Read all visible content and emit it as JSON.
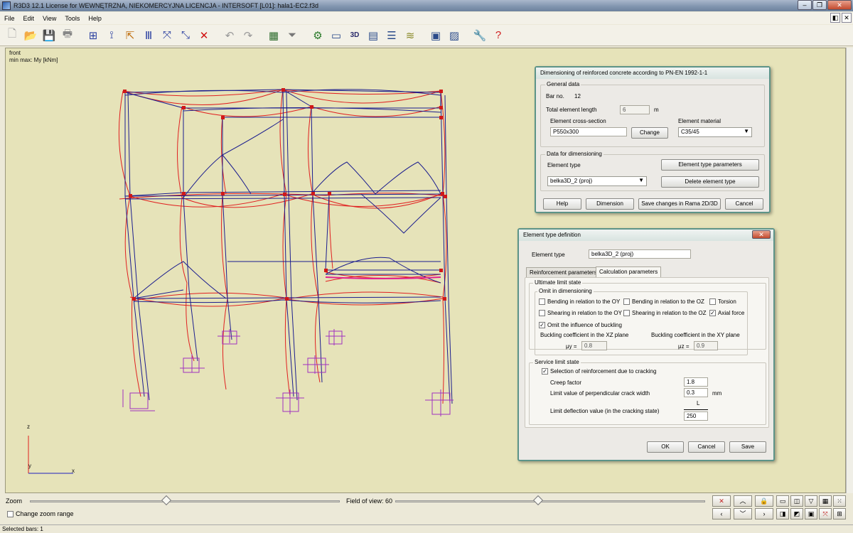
{
  "window": {
    "title": "R3D3 12.1 License for WEWNĘTRZNA, NIEKOMERCYJNA LICENCJA - INTERSOFT [L01]: hala1-EC2.f3d"
  },
  "menu": {
    "file": "File",
    "edit": "Edit",
    "view": "View",
    "tools": "Tools",
    "help": "Help"
  },
  "viewport": {
    "view_name": "front",
    "result_label": "min max: My [kNm]",
    "axis_z": "z",
    "axis_y": "y",
    "axis_x": "x"
  },
  "dim_dialog": {
    "title": "Dimensioning of reinforced concrete according to PN-EN 1992-1-1",
    "general_data": "General data",
    "bar_no_label": "Bar no.",
    "bar_no_value": "12",
    "length_label": "Total element length",
    "length_value": "6",
    "length_unit": "m",
    "cross_section_label": "Element cross-section",
    "cross_section_value": "P550x300",
    "change_button": "Change",
    "material_label": "Element material",
    "material_value": "C35/45",
    "data_for_dim": "Data for dimensioning",
    "element_type_label": "Element type",
    "element_type_value": "belka3D_2 (proj)",
    "element_type_params_button": "Element type parameters",
    "delete_element_type_button": "Delete element type",
    "help_button": "Help",
    "dimension_button": "Dimension",
    "save_changes_button": "Save changes in Rama 2D/3D",
    "cancel_button": "Cancel"
  },
  "type_dialog": {
    "title": "Element type definition",
    "element_type_label": "Element type",
    "element_type_value": "belka3D_2 (proj)",
    "tab_reinforcement": "Reinforcement parameters",
    "tab_calculation": "Calculation parameters",
    "uls_label": "Ultimate limit state",
    "omit_label": "Omit in dimensioning",
    "cb_bend_oy": "Bending in relation to the OY",
    "cb_bend_oz": "Bending in relation to the OZ",
    "cb_torsion": "Torsion",
    "cb_shear_oy": "Shearing in relation to the OY",
    "cb_shear_oz": "Shearing in relation to the OZ",
    "cb_axial": "Axial force",
    "cb_buckling": "Omit the influence of buckling",
    "buckling_xz_label": "Buckling coefficient in the XZ plane",
    "buckling_xy_label": "Buckling coefficient in the XY plane",
    "mu_y_label": "μy =",
    "mu_y_value": "0.8",
    "mu_z_label": "μz =",
    "mu_z_value": "0.9",
    "sls_label": "Service limit state",
    "cb_cracking": "Selection of reinforcement due to cracking",
    "creep_label": "Creep factor",
    "creep_value": "1.8",
    "crack_width_label": "Limit value of perpendicular crack width",
    "crack_width_value": "0.3",
    "crack_width_unit": "mm",
    "deflection_label": "Limit deflection value (in the cracking state)",
    "deflection_fraction": "L",
    "deflection_value": "250",
    "ok_button": "OK",
    "cancel_button": "Cancel",
    "save_button": "Save",
    "checked": {
      "bend_oy": false,
      "bend_oz": false,
      "torsion": false,
      "shear_oy": false,
      "shear_oz": false,
      "axial": true,
      "buckling": true,
      "cracking": true
    }
  },
  "bottom": {
    "zoom_label": "Zoom",
    "fov_label": "Field of view: 60",
    "change_zoom_range": "Change zoom range",
    "zoom_level": 0.44,
    "fov_level": 0.46
  },
  "status": {
    "text": "Selected bars: 1"
  },
  "colors": {
    "frame_blue": "#1b1d8e",
    "moment_red": "#e02020",
    "support_purple": "#a030c0",
    "node_red": "#d01818"
  }
}
